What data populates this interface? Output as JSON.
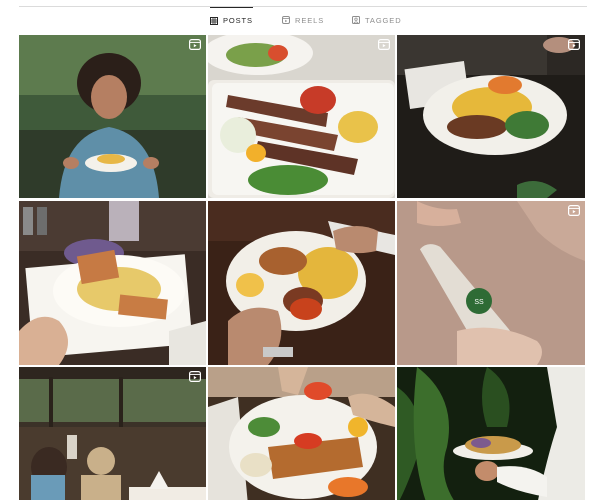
{
  "tabs": [
    {
      "label": "POSTS",
      "icon": "grid-icon",
      "active": true
    },
    {
      "label": "REELS",
      "icon": "reels-icon",
      "active": false
    },
    {
      "label": "TAGGED",
      "icon": "tagged-icon",
      "active": false
    }
  ],
  "colors": {
    "active_text": "#262626",
    "inactive_text": "#8e8e8e",
    "divider": "#dbdbdb"
  },
  "posts": [
    {
      "name": "man-with-pasta",
      "reel": true
    },
    {
      "name": "mixed-grill-platter",
      "reel": true
    },
    {
      "name": "rice-kebab-plate",
      "reel": true
    },
    {
      "name": "pasta-toast-plate",
      "reel": false
    },
    {
      "name": "biryani-cutting",
      "reel": false
    },
    {
      "name": "bottle-pour",
      "reel": true
    },
    {
      "name": "restaurant-interior",
      "reel": true
    },
    {
      "name": "grilled-fish-platter",
      "reel": false
    },
    {
      "name": "waiter-serving",
      "reel": false
    }
  ],
  "bottle_label": "SS"
}
